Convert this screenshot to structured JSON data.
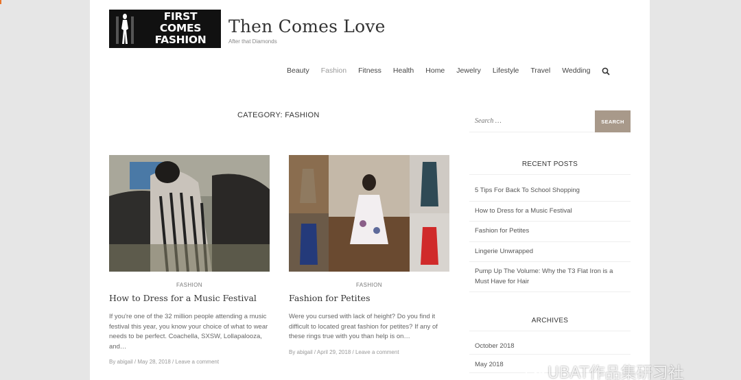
{
  "header": {
    "logo_lines": [
      "FIRST",
      "COMES",
      "FASHION"
    ],
    "site_title": "Then Comes Love",
    "tagline": "After that Diamonds"
  },
  "nav": {
    "items": [
      {
        "label": "Beauty",
        "active": false
      },
      {
        "label": "Fashion",
        "active": true
      },
      {
        "label": "Fitness",
        "active": false
      },
      {
        "label": "Health",
        "active": false
      },
      {
        "label": "Home",
        "active": false
      },
      {
        "label": "Jewelry",
        "active": false
      },
      {
        "label": "Lifestyle",
        "active": false
      },
      {
        "label": "Travel",
        "active": false
      },
      {
        "label": "Wedding",
        "active": false
      }
    ],
    "search_icon": "search-icon"
  },
  "main": {
    "category_title": "CATEGORY: FASHION",
    "posts": [
      {
        "category": "FASHION",
        "title": "How to Dress for a Music Festival",
        "excerpt": "If you're one of the 32 million people attending a music festival this year, you know your choice of what to wear needs to be perfect. Coachella, SXSW, Lollapalooza, and…",
        "meta": "By abigail / May 28, 2018 / Leave a comment"
      },
      {
        "category": "FASHION",
        "title": "Fashion for Petites",
        "excerpt": "Were you cursed with lack of height? Do you find it difficult to located great fashion for petites? If any of these rings true with you than help is on…",
        "meta": "By abigail / April 29, 2018 / Leave a comment"
      }
    ]
  },
  "sidebar": {
    "search_placeholder": "Search …",
    "search_button": "SEARCH",
    "recent_title": "RECENT POSTS",
    "recent_posts": [
      "5 Tips For Back To School Shopping",
      "How to Dress for a Music Festival",
      "Fashion for Petites",
      "Lingerie Unwrapped",
      "Pump Up The Volume: Why the T3 Flat Iron is a Must Have for Hair"
    ],
    "archives_title": "ARCHIVES",
    "archives": [
      "October 2018",
      "May 2018"
    ]
  },
  "watermark": "UBAT作品集研习社",
  "colors": {
    "search_button_bg": "#a8998a",
    "page_bg": "#e6e6e6",
    "logo_bg": "#111111"
  }
}
